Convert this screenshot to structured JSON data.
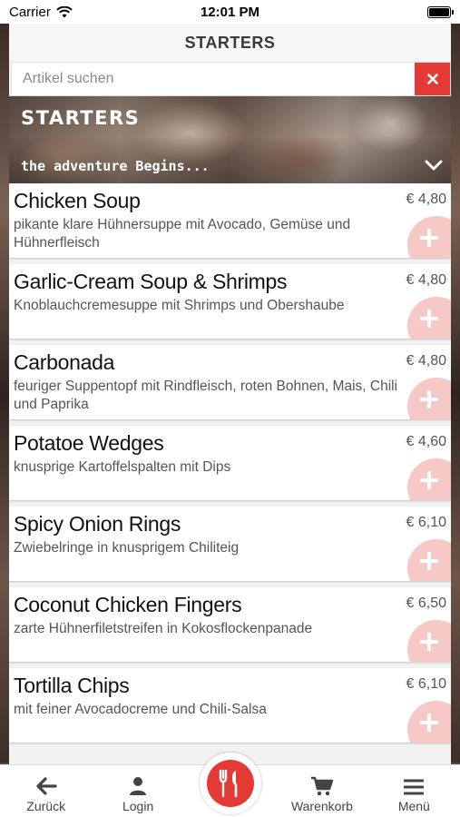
{
  "status": {
    "carrier": "Carrier",
    "time": "12:01 PM"
  },
  "header": {
    "title": "STARTERS"
  },
  "search": {
    "placeholder": "Artikel suchen",
    "clear_icon": "close-icon"
  },
  "banner": {
    "title": "STARTERS",
    "subtitle": "the adventure Begins..."
  },
  "items": [
    {
      "name": "Chicken Soup",
      "desc": "pikante klare Hühnersuppe mit Avocado, Gemüse und Hühnerfleisch",
      "price": "€ 4,80"
    },
    {
      "name": "Garlic-Cream Soup & Shrimps",
      "desc": "Knoblauchcremesuppe mit Shrimps und Obershaube",
      "price": "€ 4,80"
    },
    {
      "name": "Carbonada",
      "desc": "feuriger Suppentopf mit Rindfleisch, roten Bohnen, Mais, Chili und Paprika",
      "price": "€ 4,80"
    },
    {
      "name": "Potatoe Wedges",
      "desc": "knusprige Kartoffelspalten mit Dips",
      "price": "€ 4,60"
    },
    {
      "name": "Spicy Onion Rings",
      "desc": "Zwiebelringe in knusprigem Chiliteig",
      "price": "€ 6,10"
    },
    {
      "name": "Coconut Chicken Fingers",
      "desc": "zarte Hühnerfiletstreifen in Kokosflockenpanade",
      "price": "€ 6,50"
    },
    {
      "name": "Tortilla Chips",
      "desc": "mit feiner Avocadocreme und Chili-Salsa",
      "price": "€ 6,10"
    }
  ],
  "nav": {
    "back": "Zurück",
    "login": "Login",
    "cart": "Warenkorb",
    "menu": "Menü"
  },
  "colors": {
    "accent": "#e53935",
    "add_button": "#f6c8c6"
  }
}
